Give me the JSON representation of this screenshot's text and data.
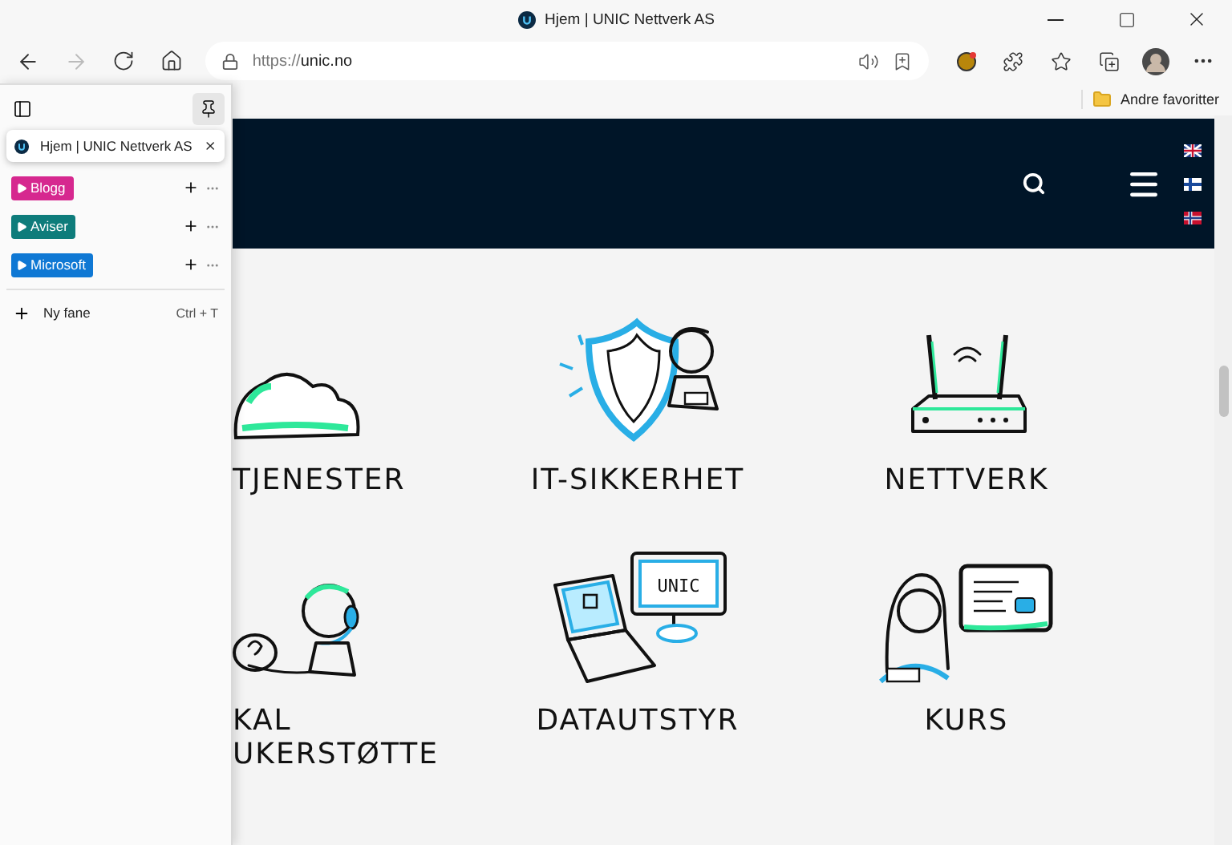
{
  "window": {
    "title": "Hjem | UNIC Nettverk AS"
  },
  "toolbar": {
    "forward_disabled": true,
    "address": {
      "scheme": "https://",
      "host": "unic.no"
    }
  },
  "favorites_bar": {
    "items": [
      {
        "label": "Andre favoritter"
      }
    ]
  },
  "sidebar": {
    "tabs": [
      {
        "title": "Hjem | UNIC Nettverk AS",
        "selected": true
      }
    ],
    "groups": [
      {
        "label": "Blogg",
        "color": "#d6288f"
      },
      {
        "label": "Aviser",
        "color": "#0e7c7b"
      },
      {
        "label": "Microsoft",
        "color": "#0f78d4"
      }
    ],
    "new_tab": {
      "label": "Ny fane",
      "shortcut": "Ctrl + T"
    }
  },
  "site": {
    "languages": [
      {
        "kind": "uk"
      },
      {
        "kind": "fi"
      },
      {
        "kind": "no"
      }
    ],
    "services": [
      {
        "kind": "cloud",
        "lines": [
          "TJENESTER"
        ]
      },
      {
        "kind": "shield",
        "lines": [
          "IT-SIKKERHET"
        ]
      },
      {
        "kind": "router",
        "lines": [
          "NETTVERK"
        ]
      },
      {
        "kind": "support",
        "lines": [
          "KAL",
          "UKERSTØTTE"
        ]
      },
      {
        "kind": "devices",
        "lines": [
          "DATAUTSTYR"
        ],
        "screen_text": "UNIC"
      },
      {
        "kind": "course",
        "lines": [
          "KURS"
        ]
      }
    ]
  }
}
